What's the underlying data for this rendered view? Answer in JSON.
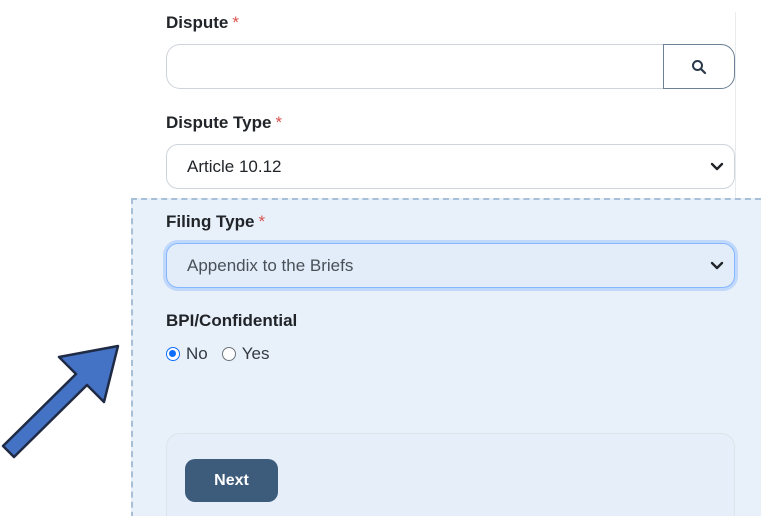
{
  "form": {
    "dispute": {
      "label": "Dispute",
      "required_marker": "*",
      "value": "",
      "search_icon": "search-icon"
    },
    "dispute_type": {
      "label": "Dispute Type",
      "required_marker": "*",
      "selected": "Article 10.12"
    },
    "filing_type": {
      "label": "Filing Type",
      "required_marker": "*",
      "selected": "Appendix to the Briefs"
    },
    "bpi": {
      "label": "BPI/Confidential",
      "options": [
        {
          "label": "No",
          "checked": true
        },
        {
          "label": "Yes",
          "checked": false
        }
      ]
    },
    "next_label": "Next"
  },
  "annotation": {
    "arrow_icon": "arrow-icon",
    "arrow_color": "#4472c4",
    "highlight_color": "#e8f0fa"
  },
  "colors": {
    "required": "#d9534f",
    "button_bg": "#3d5b7a",
    "radio_accent": "#0d6efd"
  }
}
